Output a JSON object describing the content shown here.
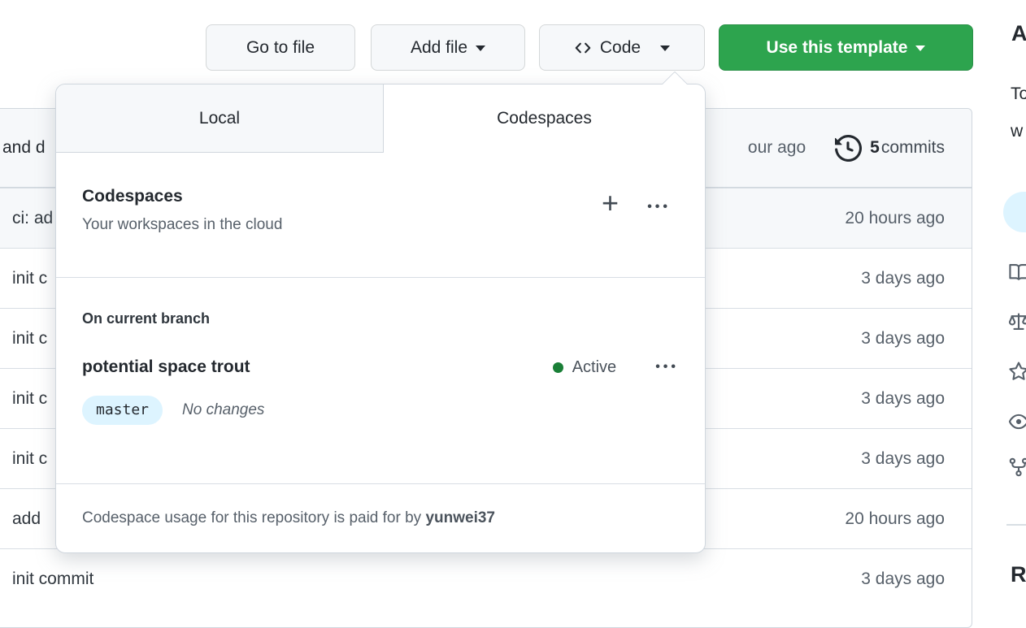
{
  "toolbar": {
    "go_to_file_label": "Go to file",
    "add_file_label": "Add file",
    "code_label": "Code",
    "use_template_label": "Use this template"
  },
  "code_dropdown": {
    "tabs": {
      "local": "Local",
      "codespaces": "Codespaces"
    },
    "codespaces_header": {
      "title": "Codespaces",
      "subtitle": "Your workspaces in the cloud",
      "plus_glyph": "+",
      "kebab_glyph": "•••"
    },
    "branch_section": {
      "heading": "On current branch",
      "codespace_name": "potential space trout",
      "status_label": "Active",
      "branch_badge": "master",
      "changes_label": "No changes",
      "kebab_glyph": "•••"
    },
    "footer": {
      "prefix": "Codespace usage for this repository is paid for by ",
      "owner": "yunwei37"
    }
  },
  "commit_bar": {
    "message_fragment": "and d",
    "time_fragment": "our ago",
    "commits_count": "5",
    "commits_word": "commits"
  },
  "file_rows": [
    {
      "message": "ci: ad",
      "time": "20 hours ago"
    },
    {
      "message": "init c",
      "time": "3 days ago"
    },
    {
      "message": "init c",
      "time": "3 days ago"
    },
    {
      "message": "init c",
      "time": "3 days ago"
    },
    {
      "message": "init c",
      "time": "3 days ago"
    },
    {
      "message": "add",
      "time": "20 hours ago"
    },
    {
      "message": "init commit",
      "time": "3 days ago"
    }
  ],
  "sidebar": {
    "about_heading_fragment": "A",
    "description_fragment_line1": "To",
    "description_fragment_line2": "w",
    "releases_heading_fragment": "R",
    "icon_names": [
      "book-icon",
      "law-icon",
      "star-icon",
      "eye-icon",
      "fork-icon"
    ]
  },
  "colors": {
    "accent_green": "#2da44e",
    "status_dot_green": "#1a7f37",
    "branch_badge_bg": "#ddf4ff",
    "muted_text": "#57606a",
    "border": "#d0d7de"
  }
}
